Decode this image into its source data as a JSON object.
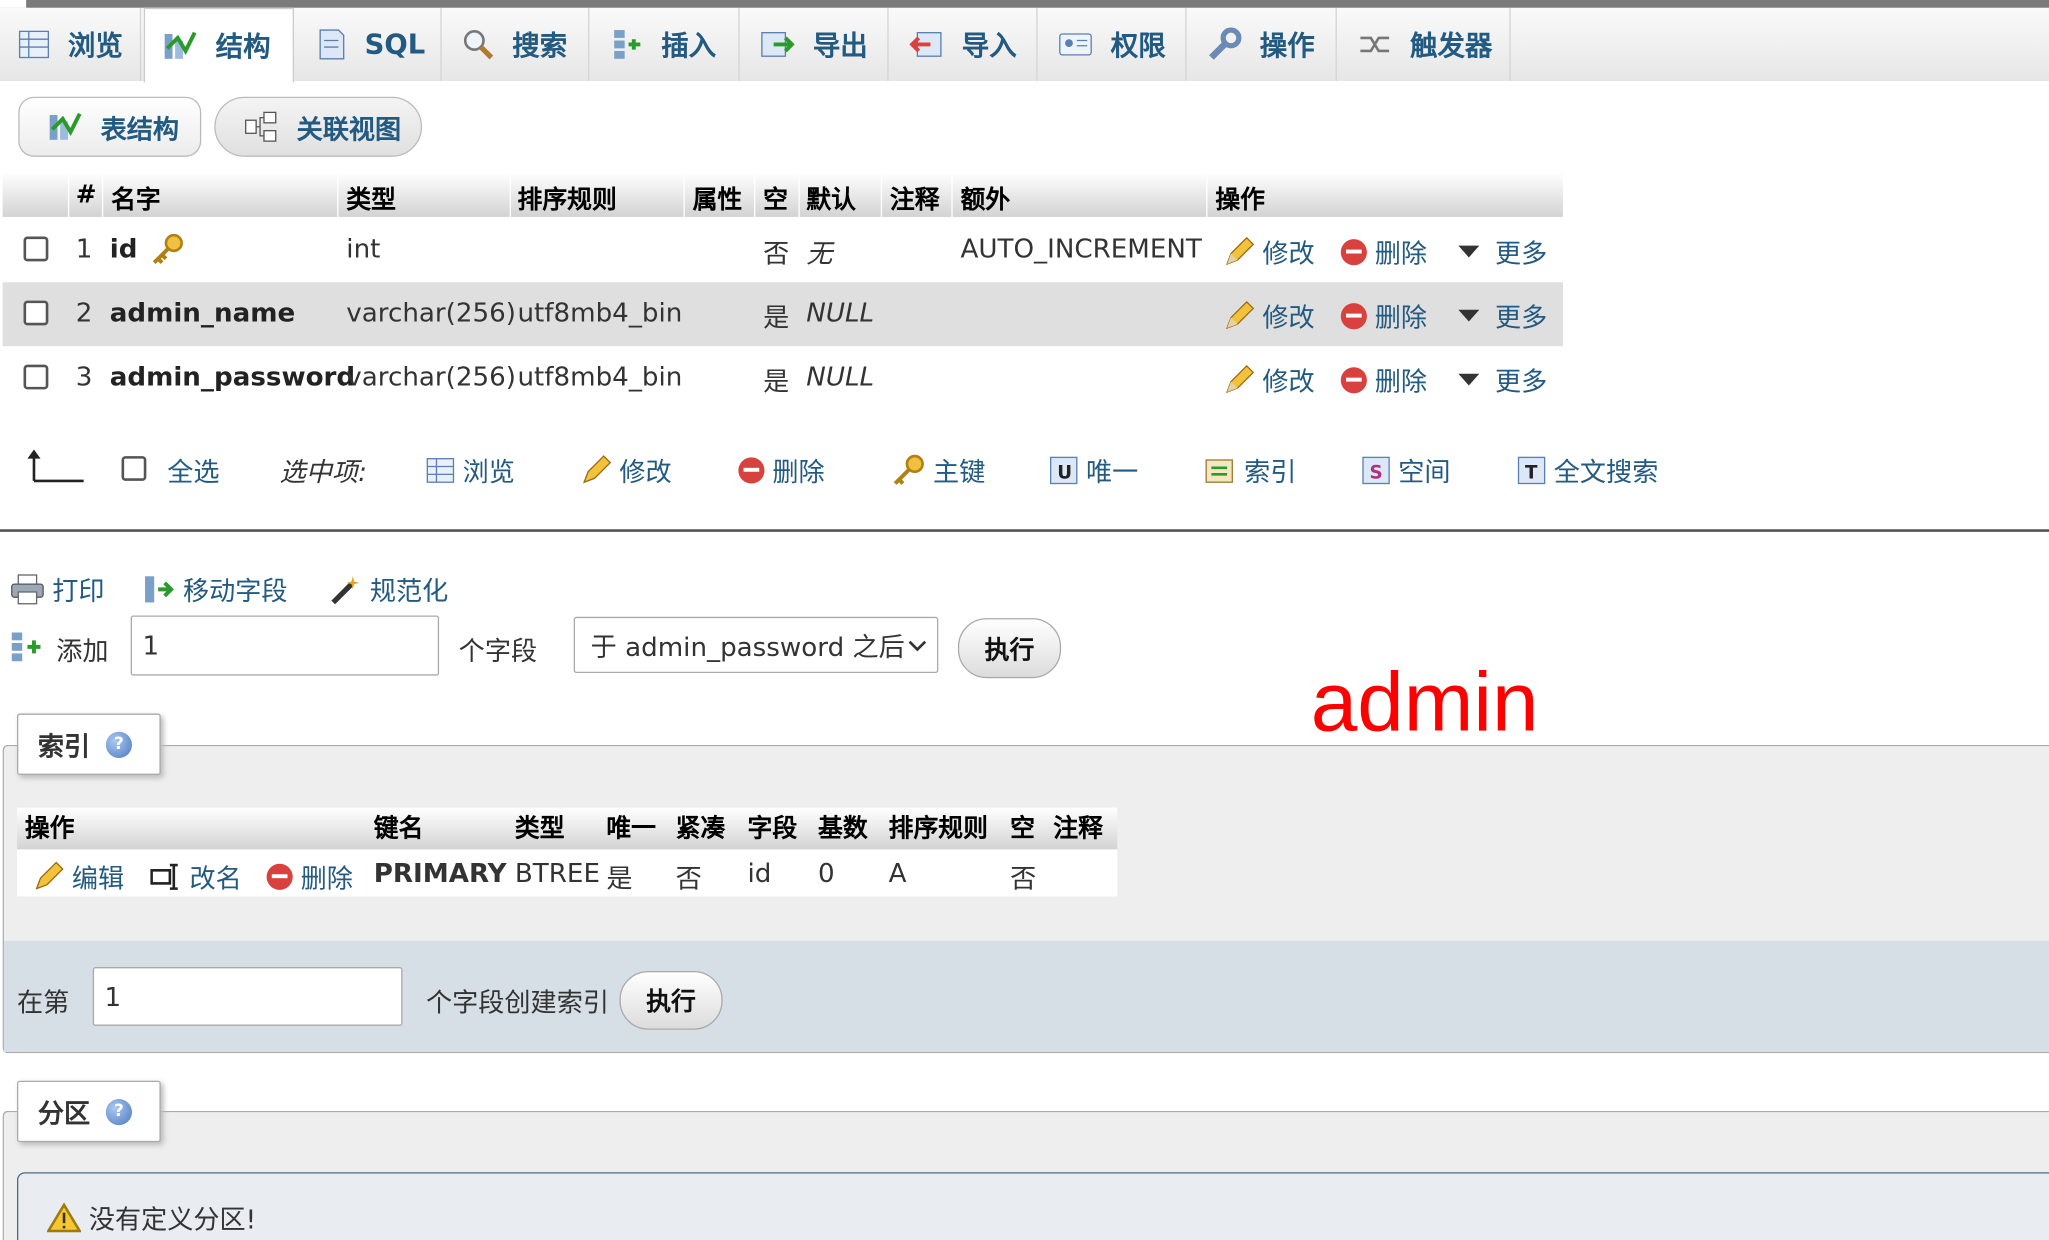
{
  "tabs": [
    {
      "label": "浏览",
      "icon": "browse-icon"
    },
    {
      "label": "结构",
      "icon": "structure-icon"
    },
    {
      "label": "SQL",
      "icon": "sql-icon"
    },
    {
      "label": "搜索",
      "icon": "search-icon"
    },
    {
      "label": "插入",
      "icon": "insert-icon"
    },
    {
      "label": "导出",
      "icon": "export-icon"
    },
    {
      "label": "导入",
      "icon": "import-icon"
    },
    {
      "label": "权限",
      "icon": "privileges-icon"
    },
    {
      "label": "操作",
      "icon": "operations-icon"
    },
    {
      "label": "触发器",
      "icon": "triggers-icon"
    }
  ],
  "subtabs": {
    "table_structure": "表结构",
    "relation_view": "关联视图"
  },
  "columns_table": {
    "headers": {
      "num": "#",
      "name": "名字",
      "type": "类型",
      "collation": "排序规则",
      "attributes": "属性",
      "null": "空",
      "default": "默认",
      "comments": "注释",
      "extra": "额外",
      "action": "操作"
    },
    "rows": [
      {
        "num": "1",
        "name": "id",
        "type": "int",
        "collation": "",
        "null": "否",
        "default": "无",
        "extra": "AUTO_INCREMENT",
        "primary_key": true
      },
      {
        "num": "2",
        "name": "admin_name",
        "type": "varchar(256)",
        "collation": "utf8mb4_bin",
        "null": "是",
        "default": "NULL",
        "extra": "",
        "primary_key": false
      },
      {
        "num": "3",
        "name": "admin_password",
        "type": "varchar(256)",
        "collation": "utf8mb4_bin",
        "null": "是",
        "default": "NULL",
        "extra": "",
        "primary_key": false
      }
    ],
    "row_actions": {
      "change": "修改",
      "drop": "删除",
      "more": "更多"
    }
  },
  "bulk": {
    "check_all": "全选",
    "with_selected": "选中项:",
    "browse": "浏览",
    "change": "修改",
    "drop": "删除",
    "primary": "主键",
    "unique": "唯一",
    "index": "索引",
    "spatial": "空间",
    "fulltext": "全文搜索"
  },
  "tools": {
    "print": "打印",
    "move_columns": "移动字段",
    "normalize": "规范化"
  },
  "add_columns": {
    "label": "添加",
    "count": "1",
    "unit": "个字段",
    "position": "于 admin_password 之后",
    "go": "执行"
  },
  "annotation": {
    "text": "admin",
    "color": "#ff0000"
  },
  "indexes": {
    "legend": "索引",
    "headers": {
      "action": "操作",
      "keyname": "键名",
      "type": "类型",
      "unique": "唯一",
      "packed": "紧凑",
      "column": "字段",
      "cardinality": "基数",
      "collation": "排序规则",
      "null": "空",
      "comment": "注释"
    },
    "row": {
      "edit": "编辑",
      "rename": "改名",
      "drop": "删除",
      "keyname": "PRIMARY",
      "type": "BTREE",
      "unique": "是",
      "packed": "否",
      "column": "id",
      "cardinality": "0",
      "collation": "A",
      "null": "否",
      "comment": ""
    },
    "create": {
      "prefix": "在第",
      "count": "1",
      "suffix": "个字段创建索引",
      "go": "执行"
    }
  },
  "partitions": {
    "legend": "分区",
    "notice": "没有定义分区!"
  },
  "colors": {
    "link": "#235a81",
    "drop": "#d9413f",
    "key": "#e8a317"
  }
}
